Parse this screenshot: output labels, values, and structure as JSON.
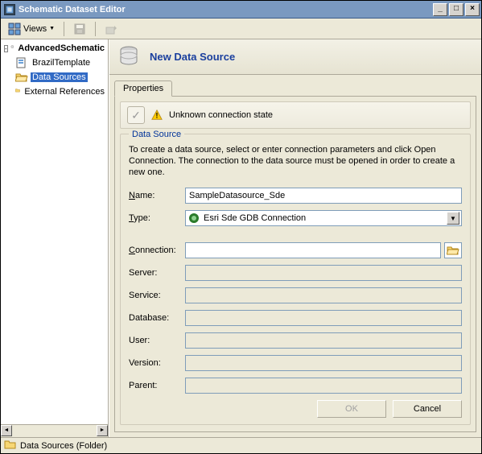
{
  "window": {
    "title": "Schematic Dataset Editor"
  },
  "toolbar": {
    "views_label": "Views"
  },
  "tree": {
    "root_label": "AdvancedSchematic",
    "items": [
      {
        "label": "BrazilTemplate"
      },
      {
        "label": "Data Sources"
      },
      {
        "label": "External References"
      }
    ]
  },
  "header": {
    "title": "New Data Source"
  },
  "tabs": {
    "properties": "Properties"
  },
  "status": {
    "text": "Unknown connection state"
  },
  "form": {
    "legend": "Data Source",
    "help": "To create a data source, select or enter connection parameters and click Open Connection.  The connection to the data source must be opened in order to create a new one.",
    "name_label": "Name:",
    "name_value": "SampleDatasource_Sde",
    "type_label": "Type:",
    "type_value": "Esri Sde GDB Connection",
    "connection_label": "Connection:",
    "connection_value": "",
    "server_label": "Server:",
    "server_value": "",
    "service_label": "Service:",
    "service_value": "",
    "database_label": "Database:",
    "database_value": "",
    "user_label": "User:",
    "user_value": "",
    "version_label": "Version:",
    "version_value": "",
    "parent_label": "Parent:",
    "parent_value": ""
  },
  "buttons": {
    "ok": "OK",
    "cancel": "Cancel"
  },
  "statusbar": {
    "text": "Data Sources (Folder)"
  }
}
